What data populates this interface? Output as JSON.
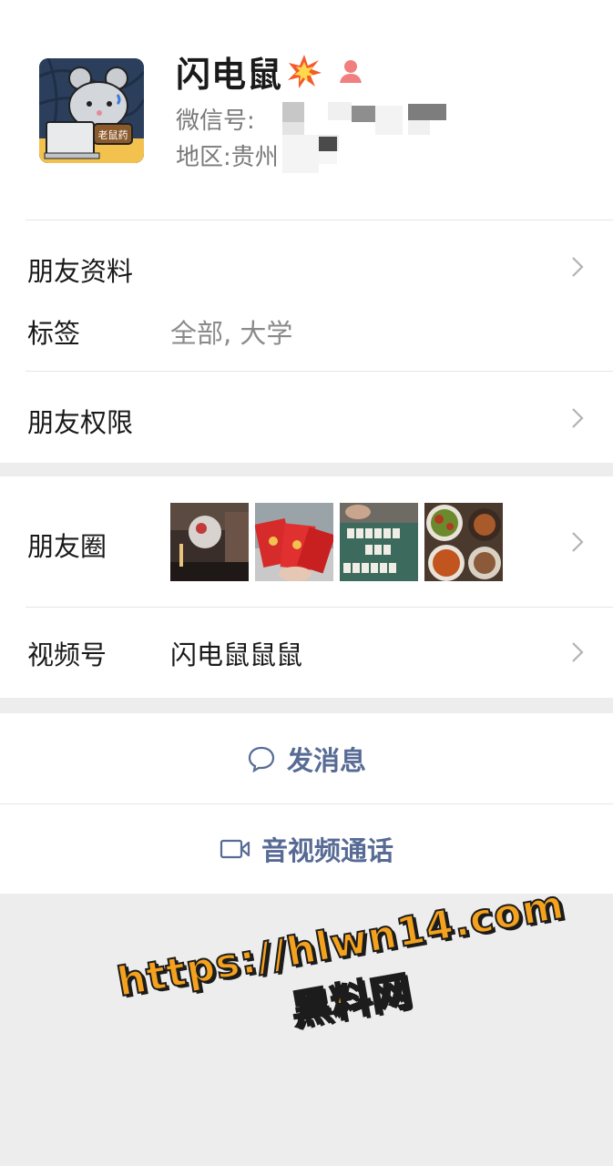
{
  "profile": {
    "name": "闪电鼠",
    "name_emoji": "burst-emoji",
    "gender_icon": "female-icon",
    "wechat_id_label": "微信号:",
    "region_label": "地区:",
    "region_value": "贵州",
    "avatar_badge_text": "老鼠药"
  },
  "details": {
    "friend_info_label": "朋友资料",
    "tags_label": "标签",
    "tags_value": "全部, 大学",
    "permissions_label": "朋友权限"
  },
  "moments": {
    "label": "朋友圈",
    "photos": [
      "party-photo",
      "red-envelopes-photo",
      "mahjong-photo",
      "food-photo"
    ]
  },
  "channels": {
    "label": "视频号",
    "value": "闪电鼠鼠鼠"
  },
  "actions": {
    "message_label": "发消息",
    "call_label": "音视频通话"
  },
  "watermark": {
    "url": "https://hlwn14.com",
    "site_name": "黑料网"
  },
  "colors": {
    "link": "#576b95",
    "watermark": "#f4a11d",
    "background": "#ededed"
  }
}
